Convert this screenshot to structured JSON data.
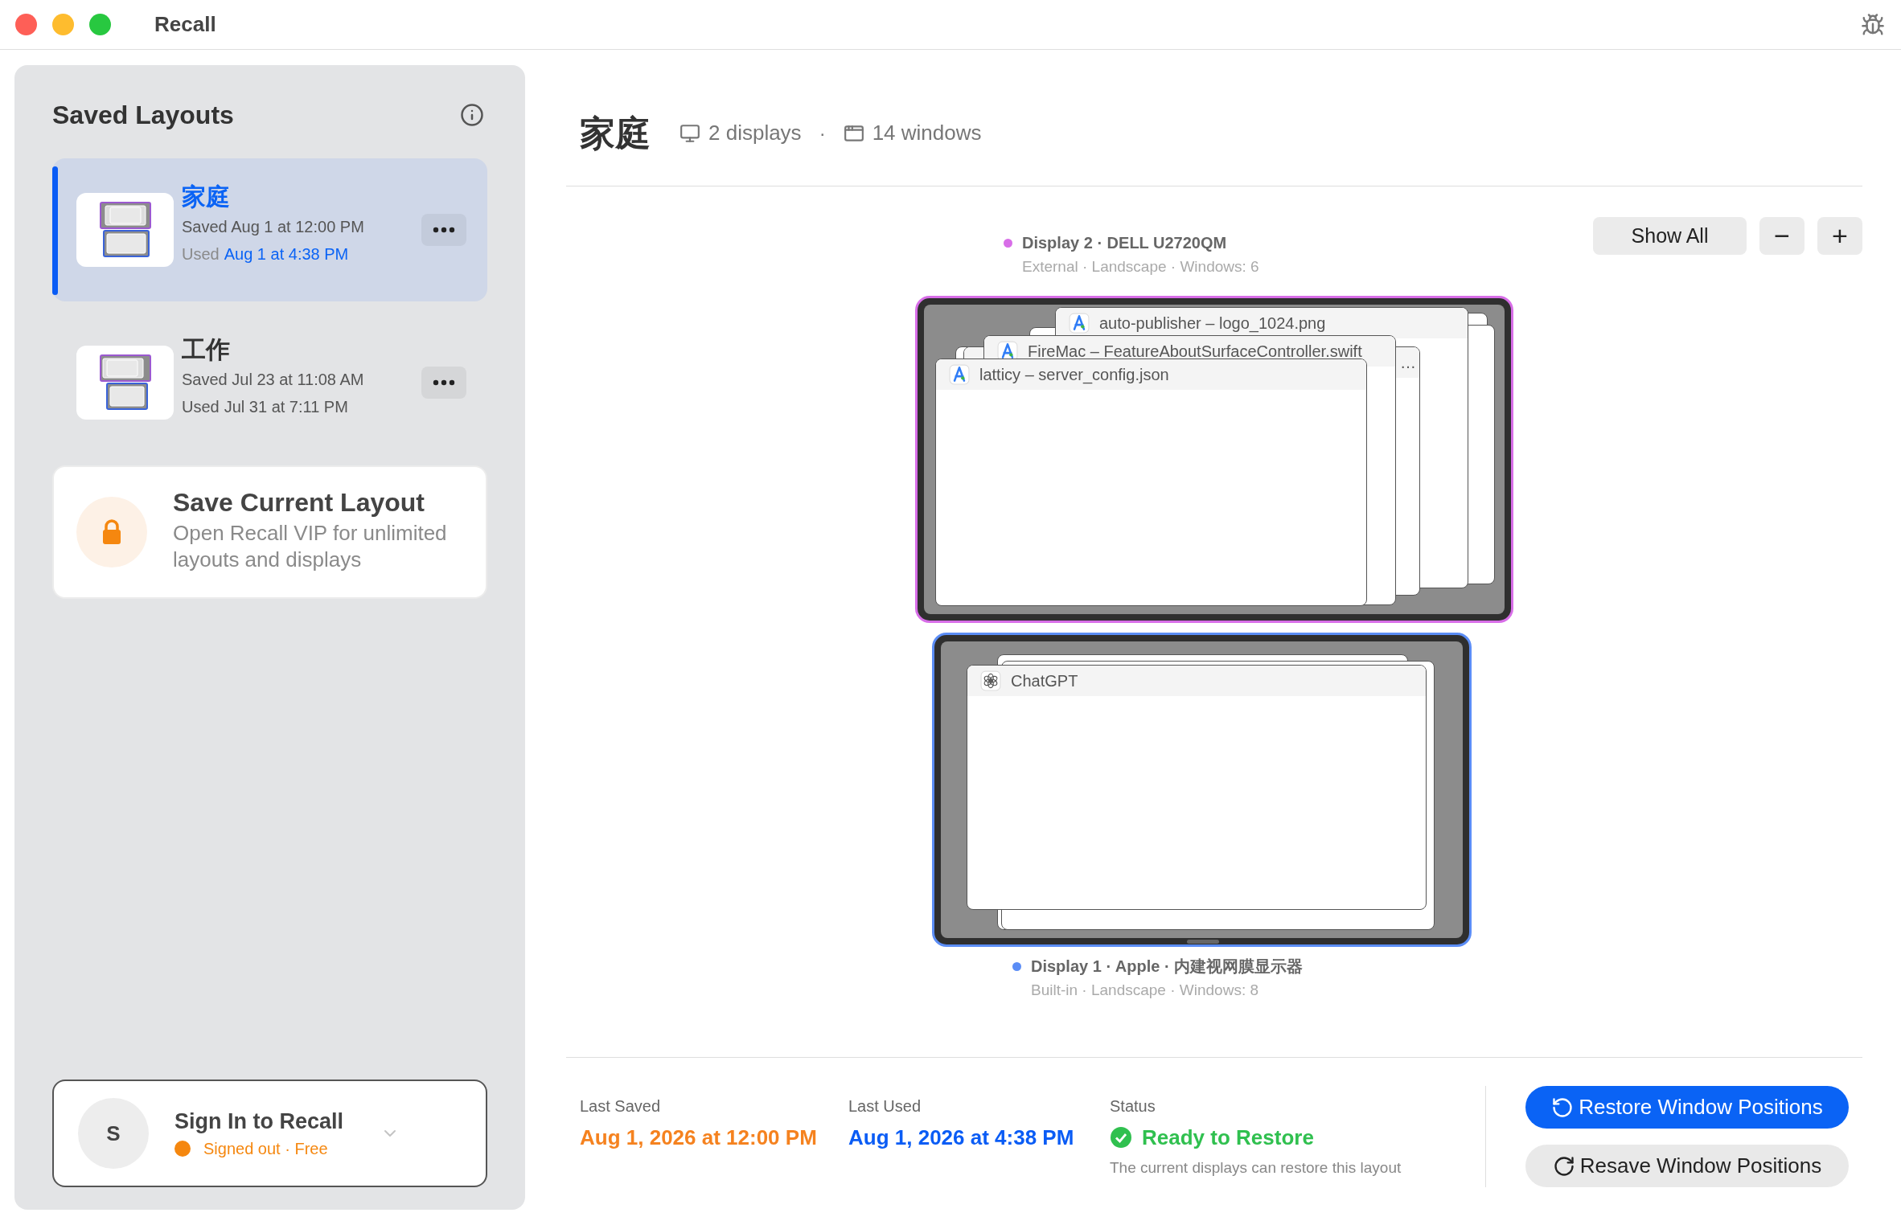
{
  "window": {
    "title": "Recall"
  },
  "sidebar": {
    "title": "Saved Layouts",
    "layouts": [
      {
        "name": "家庭",
        "saved": "Saved Aug 1 at 12:00 PM",
        "used_label": "Used",
        "used": "Aug 1 at 4:38 PM",
        "selected": true
      },
      {
        "name": "工作",
        "saved": "Saved Jul 23 at 11:08 AM",
        "used_label": "Used",
        "used": "Jul 31 at 7:11 PM",
        "selected": false
      }
    ],
    "upsell": {
      "title": "Save Current Layout",
      "description": "Open Recall VIP for unlimited layouts and displays",
      "locked": true
    },
    "account": {
      "avatar": "S",
      "title": "Sign In to Recall",
      "status": "Signed out · Free"
    }
  },
  "layout": {
    "title": "家庭",
    "displays_count": "2 displays",
    "separator": "·",
    "windows_count": "14 windows"
  },
  "canvas": {
    "controls": [
      "Show All",
      "−",
      "+"
    ],
    "displays": [
      {
        "name": "Display 2 · DELL U2720QM",
        "details": "External · Landscape · Windows: 6",
        "color": "#d86ee8",
        "windows": [
          {
            "title": "auto-publisher – logo_1024.png",
            "kind": "compass"
          },
          {
            "title": "…"
          },
          {
            "title": "FireMac – FeatureAboutSurfaceController.swift",
            "kind": "compass"
          },
          {
            "title": "latticy – server_config.json",
            "kind": "compass"
          }
        ]
      },
      {
        "name": "Display 1 · Apple · 内建视网膜显示器",
        "details": "Built-in · Landscape · Windows: 8",
        "color": "#5b8df6",
        "windows": [
          {
            "title": "ChatGPT",
            "kind": "knot"
          }
        ]
      }
    ]
  },
  "summary": {
    "last_saved_label": "Last Saved",
    "last_saved": "Aug 1, 2026 at 12:00 PM",
    "last_used_label": "Last Used",
    "last_used": "Aug 1, 2026 at 4:38 PM",
    "status_label": "Status",
    "status": "Ready to Restore",
    "status_ok": true,
    "status_note": "The current displays can restore this layout"
  },
  "actions": [
    {
      "label": "Restore Window Positions",
      "kind": "primary"
    },
    {
      "label": "Resave Window Positions",
      "kind": "secondary"
    }
  ]
}
